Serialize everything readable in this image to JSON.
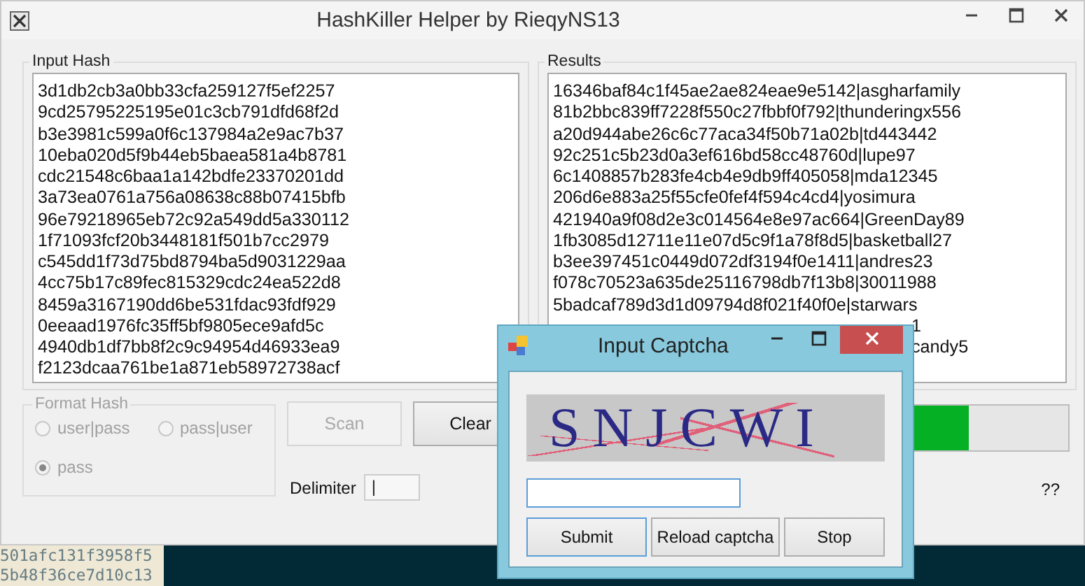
{
  "window": {
    "title": "HashKiller Helper by RieqyNS13",
    "controls": [
      {
        "kind": "minimize"
      },
      {
        "kind": "maximize"
      },
      {
        "kind": "close"
      }
    ]
  },
  "input_hash": {
    "label": "Input Hash",
    "lines": [
      "3d1db2cb3a0bb33cfa259127f5ef2257",
      "9cd25795225195e01c3cb791dfd68f2d",
      "b3e3981c599a0f6c137984a2e9ac7b37",
      "10eba020d5f9b44eb5baea581a4b8781",
      "cdc21548c6baa1a142bdfe23370201dd",
      "3a73ea0761a756a08638c88b07415bfb",
      "96e79218965eb72c92a549dd5a330112",
      "1f71093fcf20b3448181f501b7cc2979",
      "c545dd1f73d75bd8794ba5d9031229aa",
      "4cc75b17c89fec815329cdc24ea522d8",
      "8459a3167190dd6be531fdac93fdf929",
      "0eeaad1976fc35ff5bf9805ece9afd5c",
      "4940db1df7bb8f2c9c94954d46933ea9",
      "f2123dcaa761be1a871eb58972738acf"
    ]
  },
  "results": {
    "label": "Results",
    "lines": [
      {
        "kind": "full",
        "text": "16346baf84c1f45ae2ae824eae9e5142|asgharfamily"
      },
      {
        "kind": "full",
        "text": "81b2bbc839ff7228f550c27fbbf0f792|thunderingx556"
      },
      {
        "kind": "full",
        "text": "a20d944abe26c6c77aca34f50b71a02b|td443442"
      },
      {
        "kind": "full",
        "text": "92c251c5b23d0a3ef616bd58cc48760d|lupe97"
      },
      {
        "kind": "full",
        "text": "6c1408857b283fe4cb4e9db9ff405058|mda12345"
      },
      {
        "kind": "full",
        "text": "206d6e883a25f55cfe0fef4f594c4cd4|yosimura"
      },
      {
        "kind": "full",
        "text": "421940a9f08d2e3c014564e8e97ac664|GreenDay89"
      },
      {
        "kind": "full",
        "text": "1fb3085d12711e11e07d5c9f1a78f8d5|basketball27"
      },
      {
        "kind": "full",
        "text": "b3ee397451c0449d072df3194f0e1411|andres23"
      },
      {
        "kind": "full",
        "text": "f078c70523a635de25116798db7f13b8|30011988"
      },
      {
        "kind": "full",
        "text": "5badcaf789d3d1d09794d8f021f40f0e|starwars"
      },
      {
        "kind": "tail",
        "text": "1"
      },
      {
        "kind": "tail",
        "text": "candy5"
      }
    ]
  },
  "format_hash": {
    "label": "Format Hash",
    "disabled": true,
    "options": [
      {
        "label": "user|pass",
        "selected": false
      },
      {
        "label": "pass|user",
        "selected": false
      },
      {
        "label": "pass",
        "selected": true
      }
    ]
  },
  "buttons": [
    {
      "label": "Scan",
      "disabled": true
    },
    {
      "label": "Clear",
      "disabled": false
    }
  ],
  "delimiter": {
    "label": "Delimiter",
    "value": "|"
  },
  "progress": {
    "level": 0.81
  },
  "status": "??",
  "terminal_lines": [
    "501afc131f3958f5",
    "5b48f36ce7d10c13"
  ],
  "captcha_dialog": {
    "title": "Input Captcha",
    "controls": [
      {
        "kind": "minimize"
      },
      {
        "kind": "maximize"
      },
      {
        "kind": "close"
      }
    ],
    "captcha_text": "SNJCWI",
    "buttons": [
      {
        "label": "Submit",
        "focused": true
      },
      {
        "label": "Reload captcha",
        "focused": false
      },
      {
        "label": "Stop",
        "focused": false
      }
    ]
  }
}
